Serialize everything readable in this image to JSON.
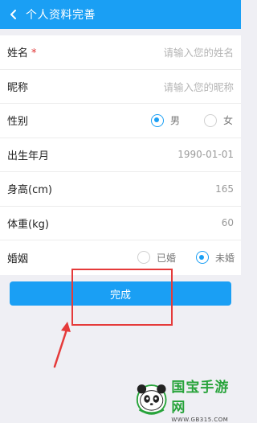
{
  "header": {
    "title": "个人资料完善"
  },
  "form": {
    "name": {
      "label": "姓名",
      "required_mark": "*",
      "placeholder": "请输入您的姓名"
    },
    "nickname": {
      "label": "昵称",
      "placeholder": "请输入您的昵称"
    },
    "gender": {
      "label": "性别",
      "options": [
        "男",
        "女"
      ],
      "selected": "男"
    },
    "birthday": {
      "label": "出生年月",
      "value": "1990-01-01"
    },
    "height": {
      "label": "身高(cm)",
      "value": "165"
    },
    "weight": {
      "label": "体重(kg)",
      "value": "60"
    },
    "marriage": {
      "label": "婚姻",
      "options": [
        "已婚",
        "未婚"
      ],
      "selected": "未婚"
    }
  },
  "submit_label": "完成",
  "watermark": {
    "title": "国宝手游网",
    "url": "WWW.GB315.COM"
  },
  "colors": {
    "accent": "#1a9ff4",
    "annotation": "#e53a3a"
  }
}
